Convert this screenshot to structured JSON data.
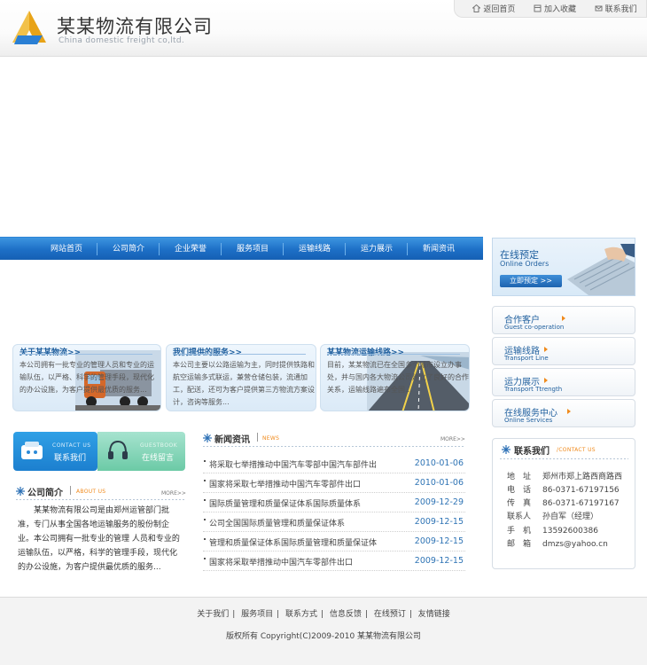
{
  "brand": {
    "name_cn": "某某物流有限公司",
    "name_en": "China domestic freight co,ltd."
  },
  "toplinks": [
    {
      "label": "返回首页",
      "icon": "home-icon"
    },
    {
      "label": "加入收藏",
      "icon": "favorite-icon"
    },
    {
      "label": "联系我们",
      "icon": "contact-icon"
    }
  ],
  "nav": [
    "网站首页",
    "公司简介",
    "企业荣誉",
    "服务项目",
    "运输线路",
    "运力展示",
    "新闻资讯"
  ],
  "order": {
    "title": "在线预定",
    "subtitle": "Online Orders",
    "button": "立即预定 >>"
  },
  "side_menu": [
    {
      "cn": "合作客户",
      "en": "Guest co-operation"
    },
    {
      "cn": "运输线路",
      "en": "Transport Line"
    },
    {
      "cn": "运力展示",
      "en": "Transport Ttrength"
    },
    {
      "cn": "在线服务中心",
      "en": "Online Services"
    }
  ],
  "cards": [
    {
      "title": "关于某某物流>>",
      "text": "本公司拥有一批专业的管理人员和专业的运输队伍，以严格、科学的管理手段，现代化的办公设施，为客户提供最优质的服务..."
    },
    {
      "title": "我们提供的服务>>",
      "text": "本公司主要以公路运输为主，同时提供铁路和航空运输多式联运，兼营仓储包装，流通加工，配送，还可为客户提供第三方物流方案设计，咨询等服务..."
    },
    {
      "title": "某某物流运输线路>>",
      "text": "目前，某某物流已在全国多个城市设立办事处，并与国内各大物流公司建立了良好的合作关系，运输线路遍布全国..."
    }
  ],
  "contact_boxes": {
    "left": {
      "en": "CONTACT US",
      "cn": "联系我们"
    },
    "right": {
      "en": "GUESTBOOK",
      "cn": "在线留言"
    }
  },
  "about": {
    "title": "公司简介",
    "en": "ABOUT US",
    "more": "MORE>>",
    "text": "某某物流有限公司是由郑州运管部门批准，专门从事全国各地运输服务的股份制企业。本公司拥有一批专业的管理 人员和专业的运输队伍，以严格，科学的管理手段，现代化的办公设施，为客户提供最优质的服务..."
  },
  "news": {
    "title": "新闻资讯",
    "en": "NEWS",
    "more": "MORE>>",
    "items": [
      {
        "title": "将采取七举措推动中国汽车零部中国汽车部件出",
        "date": "2010-01-06"
      },
      {
        "title": "国家将采取七举措推动中国汽车零部件出口",
        "date": "2010-01-06"
      },
      {
        "title": "国际质量管理和质量保证体系国际质量体系",
        "date": "2009-12-29"
      },
      {
        "title": "公司全国国际质量管理和质量保证体系",
        "date": "2009-12-15"
      },
      {
        "title": "管理和质量保证体系国际质量管理和质量保证体",
        "date": "2009-12-15"
      },
      {
        "title": "国家将采取举措推动中国汽车零部件出口",
        "date": "2009-12-15"
      }
    ]
  },
  "contact": {
    "title": "联系我们",
    "en": "/CONTACT US",
    "rows": [
      {
        "k": "地　址",
        "v": "郑州市郑上路西商路西"
      },
      {
        "k": "电　话",
        "v": "86-0371-67197156"
      },
      {
        "k": "传　真",
        "v": "86-0371-67197167"
      },
      {
        "k": "联系人",
        "v": "孙自军（经理）"
      },
      {
        "k": "手　机",
        "v": "13592600386"
      },
      {
        "k": "邮　箱",
        "v": "dmzs@yahoo.cn"
      }
    ]
  },
  "footer": {
    "links": [
      "关于我们",
      "服务项目",
      "联系方式",
      "信息反馈",
      "在线预订",
      "友情链接"
    ],
    "copyright": "版权所有 Copyright(C)2009-2010 某某物流有限公司"
  },
  "colors": {
    "nav": "#1d6fc6",
    "accent": "#f08a1c",
    "link": "#1f5f9e",
    "date": "#2f74b5"
  }
}
